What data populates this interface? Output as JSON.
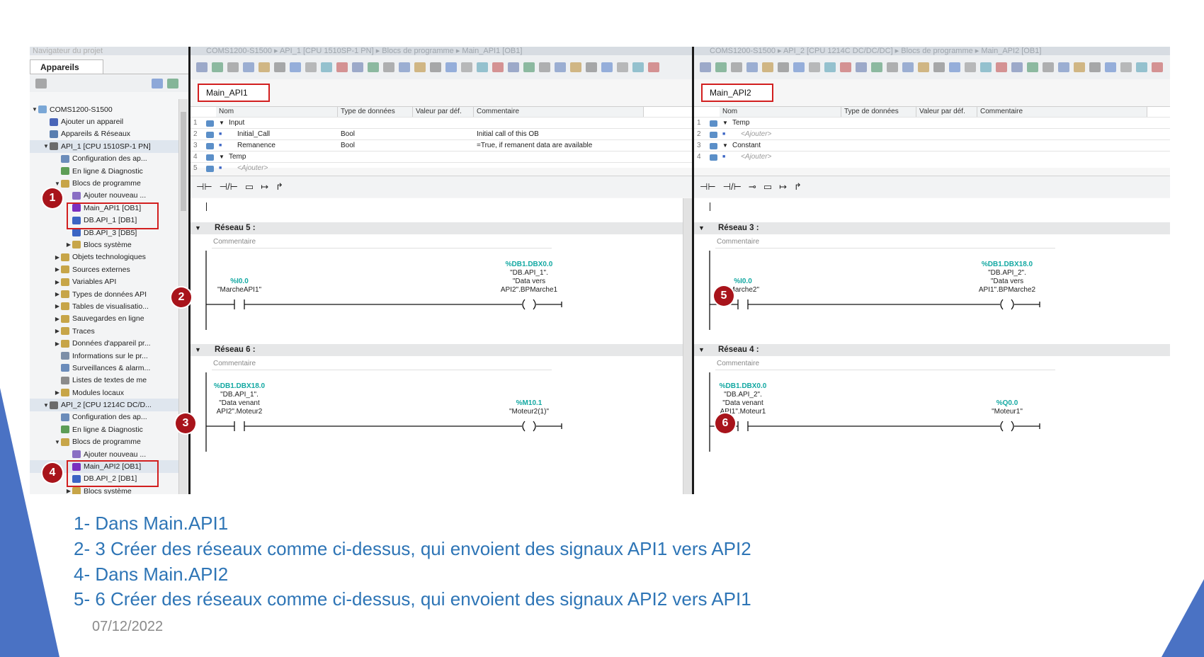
{
  "navigator": {
    "title": "Navigateur du projet",
    "tab": "Appareils",
    "tree": [
      {
        "label": "COMS1200-S1500",
        "indent": 0,
        "arrow": "▼",
        "icon": "#7aa7d6"
      },
      {
        "label": "Ajouter un appareil",
        "indent": 1,
        "arrow": "",
        "icon": "#4a66b8"
      },
      {
        "label": "Appareils & Réseaux",
        "indent": 1,
        "arrow": "",
        "icon": "#5a7fb0"
      },
      {
        "label": "API_1 [CPU 1510SP-1 PN]",
        "indent": 1,
        "arrow": "▼",
        "icon": "#6b6b6b",
        "sel": true
      },
      {
        "label": "Configuration des ap...",
        "indent": 2,
        "arrow": "",
        "icon": "#6b8cba"
      },
      {
        "label": "En ligne & Diagnostic",
        "indent": 2,
        "arrow": "",
        "icon": "#5d9d56"
      },
      {
        "label": "Blocs de programme",
        "indent": 2,
        "arrow": "▼",
        "icon": "#c7a548"
      },
      {
        "label": "Ajouter nouveau ...",
        "indent": 3,
        "arrow": "",
        "icon": "#8a6fc4"
      },
      {
        "label": "Main_API1 [OB1]",
        "indent": 3,
        "arrow": "",
        "icon": "#7a2fbf"
      },
      {
        "label": "DB.API_1 [DB1]",
        "indent": 3,
        "arrow": "",
        "icon": "#3b64c4"
      },
      {
        "label": "DB.API_3 [DB5]",
        "indent": 3,
        "arrow": "",
        "icon": "#3b64c4"
      },
      {
        "label": "Blocs système",
        "indent": 3,
        "arrow": "▶",
        "icon": "#c7a548"
      },
      {
        "label": "Objets technologiques",
        "indent": 2,
        "arrow": "▶",
        "icon": "#c7a548"
      },
      {
        "label": "Sources externes",
        "indent": 2,
        "arrow": "▶",
        "icon": "#c7a548"
      },
      {
        "label": "Variables API",
        "indent": 2,
        "arrow": "▶",
        "icon": "#c7a548"
      },
      {
        "label": "Types de données API",
        "indent": 2,
        "arrow": "▶",
        "icon": "#c7a548"
      },
      {
        "label": "Tables de visualisatio...",
        "indent": 2,
        "arrow": "▶",
        "icon": "#c7a548"
      },
      {
        "label": "Sauvegardes en ligne",
        "indent": 2,
        "arrow": "▶",
        "icon": "#c7a548"
      },
      {
        "label": "Traces",
        "indent": 2,
        "arrow": "▶",
        "icon": "#c7a548"
      },
      {
        "label": "Données d'appareil pr...",
        "indent": 2,
        "arrow": "▶",
        "icon": "#c7a548"
      },
      {
        "label": "Informations sur le pr...",
        "indent": 2,
        "arrow": "",
        "icon": "#7d8fa8"
      },
      {
        "label": "Surveillances & alarm...",
        "indent": 2,
        "arrow": "",
        "icon": "#6b8cba"
      },
      {
        "label": "Listes de textes de me",
        "indent": 2,
        "arrow": "",
        "icon": "#8b8b8b"
      },
      {
        "label": "Modules locaux",
        "indent": 2,
        "arrow": "▶",
        "icon": "#c7a548"
      },
      {
        "label": "API_2 [CPU 1214C DC/D...",
        "indent": 1,
        "arrow": "▼",
        "icon": "#6b6b6b",
        "sel": true
      },
      {
        "label": "Configuration des ap...",
        "indent": 2,
        "arrow": "",
        "icon": "#6b8cba"
      },
      {
        "label": "En ligne & Diagnostic",
        "indent": 2,
        "arrow": "",
        "icon": "#5d9d56"
      },
      {
        "label": "Blocs de programme",
        "indent": 2,
        "arrow": "▼",
        "icon": "#c7a548"
      },
      {
        "label": "Ajouter nouveau ...",
        "indent": 3,
        "arrow": "",
        "icon": "#8a6fc4"
      },
      {
        "label": "Main_API2 [OB1]",
        "indent": 3,
        "arrow": "",
        "icon": "#7a2fbf",
        "sel": true
      },
      {
        "label": "DB.API_2 [DB1]",
        "indent": 3,
        "arrow": "",
        "icon": "#3b64c4"
      },
      {
        "label": "Blocs système",
        "indent": 3,
        "arrow": "▶",
        "icon": "#c7a548"
      }
    ]
  },
  "editor1": {
    "breadcrumb": "COMS1200-S1500 ▸ API_1 [CPU 1510SP-1 PN] ▸ Blocs de programme ▸ Main_API1 [OB1]",
    "block_name": "Main_API1",
    "headers": [
      "Nom",
      "Type de données",
      "Valeur par déf.",
      "Commentaire"
    ],
    "rows": [
      {
        "n": "1",
        "name": "Input",
        "type": "",
        "comment": "",
        "section": true
      },
      {
        "n": "2",
        "name": "Initial_Call",
        "type": "Bool",
        "comment": "Initial call of this OB"
      },
      {
        "n": "3",
        "name": "Remanence",
        "type": "Bool",
        "comment": "=True, if remanent data are available"
      },
      {
        "n": "4",
        "name": "Temp",
        "type": "",
        "comment": "",
        "section": true
      },
      {
        "n": "5",
        "name": "<Ajouter>",
        "type": "",
        "comment": "",
        "add": true
      }
    ],
    "networks": [
      {
        "title": "Réseau 5 :",
        "comment": "Commentaire",
        "contact_addr": "%I0.0",
        "contact_name": "\"MarcheAPI1\"",
        "coil_addr": "%DB1.DBX0.0",
        "coil_name": [
          "\"DB.API_1\".",
          "\"Data vers",
          "API2\".BPMarche1"
        ]
      },
      {
        "title": "Réseau 6 :",
        "comment": "Commentaire",
        "contact_addr": "%DB1.DBX18.0",
        "contact_name": [
          "\"DB.API_1\".",
          "\"Data venant",
          "API2\".Moteur2"
        ],
        "coil_addr": "%M10.1",
        "coil_name": [
          "\"Moteur2(1)\""
        ]
      }
    ]
  },
  "editor2": {
    "breadcrumb": "COMS1200-S1500 ▸ API_2 [CPU 1214C DC/DC/DC] ▸ Blocs de programme ▸ Main_API2 [OB1]",
    "block_name": "Main_API2",
    "headers": [
      "Nom",
      "Type de données",
      "Valeur par déf.",
      "Commentaire"
    ],
    "rows": [
      {
        "n": "1",
        "name": "Temp",
        "type": "",
        "comment": "",
        "section": true
      },
      {
        "n": "2",
        "name": "<Ajouter>",
        "type": "",
        "comment": "",
        "add": true
      },
      {
        "n": "3",
        "name": "Constant",
        "type": "",
        "comment": "",
        "section": true
      },
      {
        "n": "4",
        "name": "<Ajouter>",
        "type": "",
        "comment": "",
        "add": true
      }
    ],
    "networks": [
      {
        "title": "Réseau 3 :",
        "comment": "Commentaire",
        "contact_addr": "%I0.0",
        "contact_name": "\"Marche2\"",
        "coil_addr": "%DB1.DBX18.0",
        "coil_name": [
          "\"DB.API_2\".",
          "\"Data vers",
          "API1\".BPMarche2"
        ]
      },
      {
        "title": "Réseau 4 :",
        "comment": "Commentaire",
        "contact_addr": "%DB1.DBX0.0",
        "contact_name": [
          "\"DB.API_2\".",
          "\"Data venant",
          "API1\".Moteur1"
        ],
        "coil_addr": "%Q0.0",
        "coil_name": [
          "\"Moteur1\""
        ]
      }
    ]
  },
  "ladder_tools": [
    "⊣⊢",
    "⊣/⊢",
    "▭",
    "↦",
    "↱"
  ],
  "ladder_tools2": [
    "⊣⊢",
    "⊣/⊢",
    "⊸",
    "▭",
    "↦",
    "↱"
  ],
  "badges": [
    "1",
    "2",
    "3",
    "4",
    "5",
    "6"
  ],
  "notes": [
    "1- Dans Main.API1",
    "2- 3 Créer des réseaux comme ci-dessus, qui envoient des signaux API1 vers API2",
    "4- Dans Main.API2",
    "5- 6 Créer des réseaux comme ci-dessus, qui envoient des signaux API2 vers API1"
  ],
  "date": "07/12/2022",
  "colors": {
    "accent": "#2e75b6",
    "badge": "#a8141b",
    "highlight": "#d21f1f",
    "address": "#13a8a2"
  }
}
